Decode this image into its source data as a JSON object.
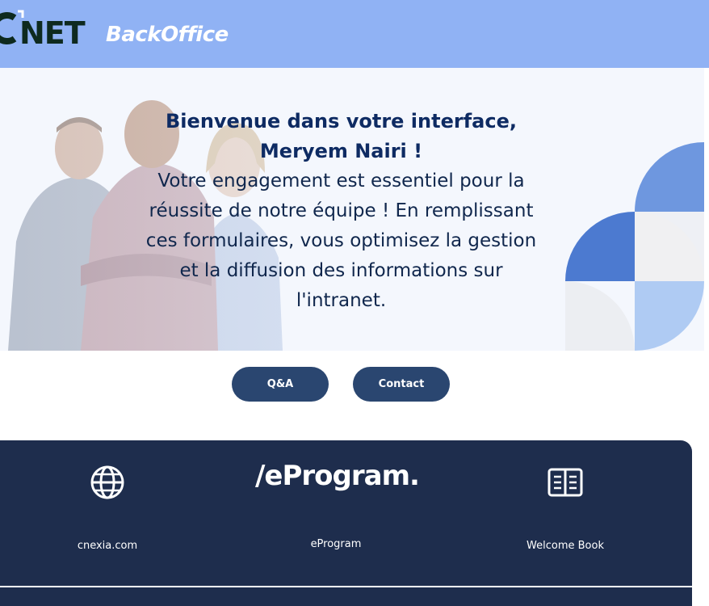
{
  "header": {
    "logo_text": "NET",
    "logo_subtitle": "BackOffice",
    "background_color": "#90b2f4"
  },
  "hero": {
    "welcome": "Bienvenue dans votre interface, Meryem Nairi !",
    "message": "Votre engagement est essentiel pour la réussite de notre équipe ! En remplissant ces formulaires, vous optimisez la gestion et la diffusion des informations sur l'intranet."
  },
  "buttons": {
    "qa": "Q&A",
    "contact": "Contact",
    "color": "#2a4670"
  },
  "footer": {
    "background_color": "#1e2d4d",
    "links": [
      {
        "label": "cnexia.com",
        "icon": "globe-icon"
      },
      {
        "label": "eProgram",
        "logo_text": "/eProgram.",
        "icon": "eprogram-logo"
      },
      {
        "label": "Welcome Book",
        "icon": "book-icon"
      }
    ]
  }
}
